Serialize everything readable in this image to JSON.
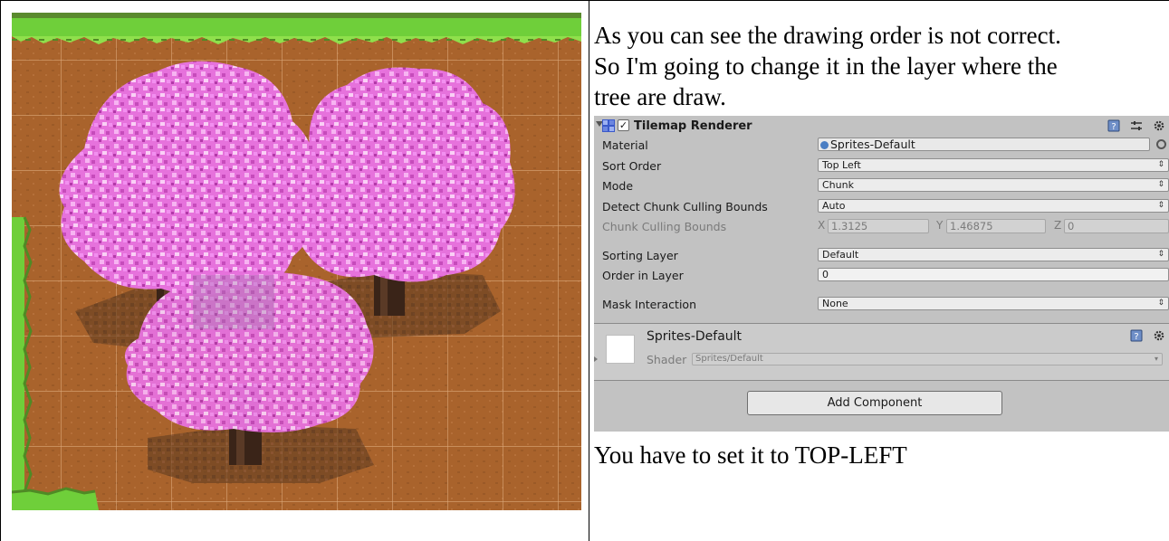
{
  "doc": {
    "paragraph_1": "As  you can see the drawing order is not correct.",
    "paragraph_2": "So I'm going to change it in the layer where the",
    "paragraph_3": "tree are draw.",
    "paragraph_4": "You have to set it to TOP-LEFT"
  },
  "inspector": {
    "component_title": "Tilemap Renderer",
    "component_enabled": true,
    "icons": [
      "tilemap-renderer-icon",
      "book-icon",
      "settings-sliders-icon",
      "gear-icon"
    ],
    "colors": {
      "panel": "#c2c2c2",
      "field": "#f1f1f1",
      "object_dot": "#4a7ec3"
    },
    "rows": {
      "material": {
        "label": "Material",
        "value": "Sprites-Default"
      },
      "sort_order": {
        "label": "Sort Order",
        "value": "Top Left"
      },
      "mode": {
        "label": "Mode",
        "value": "Chunk"
      },
      "detect_bounds": {
        "label": "Detect Chunk Culling Bounds",
        "value": "Auto"
      },
      "chunk_bounds": {
        "label": "Chunk Culling Bounds",
        "x_label": "X",
        "x": "1.3125",
        "y_label": "Y",
        "y": "1.46875",
        "z_label": "Z",
        "z": "0"
      },
      "sorting_layer": {
        "label": "Sorting Layer",
        "value": "Default"
      },
      "order_in_layer": {
        "label": "Order in Layer",
        "value": "0"
      },
      "mask_interaction": {
        "label": "Mask Interaction",
        "value": "None"
      }
    },
    "material_block": {
      "name": "Sprites-Default",
      "shader_label": "Shader",
      "shader_value": "Sprites/Default"
    },
    "add_component_label": "Add Component"
  },
  "scene": {
    "colors": {
      "dirt": "#a9632c",
      "grass": "#6fcf3a",
      "blossom": "#f28ff0",
      "trunk": "#3a2418",
      "grid": "#e0b486"
    }
  }
}
